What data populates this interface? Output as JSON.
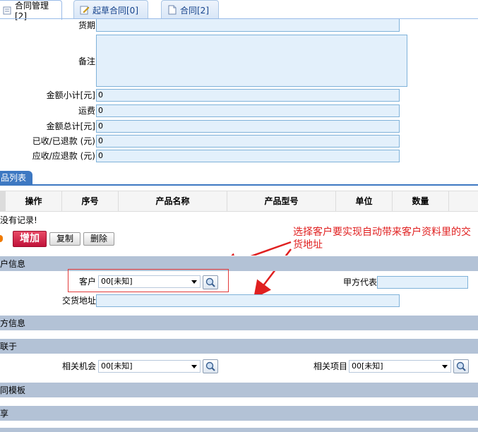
{
  "tabs": [
    {
      "label": "合同管理[2]",
      "icon": "list-icon",
      "active": true
    },
    {
      "label": "起草合同[0]",
      "icon": "edit-doc-icon",
      "active": false
    },
    {
      "label": "合同[2]",
      "icon": "document-icon",
      "active": false
    }
  ],
  "fields": {
    "delivery_period": {
      "label": "货期",
      "value": ""
    },
    "remarks": {
      "label": "备注",
      "value": ""
    },
    "subtotal": {
      "label": "金额小计[元]",
      "value": "0"
    },
    "freight": {
      "label": "运费",
      "value": "0"
    },
    "total": {
      "label": "金额总计[元]",
      "value": "0"
    },
    "received_refunded": {
      "label": "已收/已退款 (元)",
      "value": "0"
    },
    "receivable_refundable": {
      "label": "应收/应退款 (元)",
      "value": "0"
    }
  },
  "product_list": {
    "tab_label": "品列表",
    "columns": [
      "操作",
      "序号",
      "产品名称",
      "产品型号",
      "单位",
      "数量"
    ],
    "empty_text": "没有记录!",
    "add_label": "增加",
    "copy_label": "复制",
    "delete_label": "删除"
  },
  "sections": {
    "customer_info": "户信息",
    "party_info": "方信息",
    "related_to": "联于",
    "contract_template": "同模板",
    "share": "享"
  },
  "customer": {
    "customer_label": "客户",
    "customer_value": "00[未知]",
    "party_a_rep_label": "甲方代表",
    "party_a_rep_value": "",
    "delivery_address_label": "交货地址",
    "delivery_address_value": ""
  },
  "related": {
    "opportunity_label": "相关机会",
    "opportunity_value": "00[未知]",
    "project_label": "相关项目",
    "project_value": "00[未知]"
  },
  "annotation": "选择客户要实现自动带来客户资料里的交货地址",
  "colors": {
    "annotation": "#e02020",
    "accent": "#3d78c2",
    "section_bar": "#b3c2d6",
    "add_button": "#c0123a"
  }
}
